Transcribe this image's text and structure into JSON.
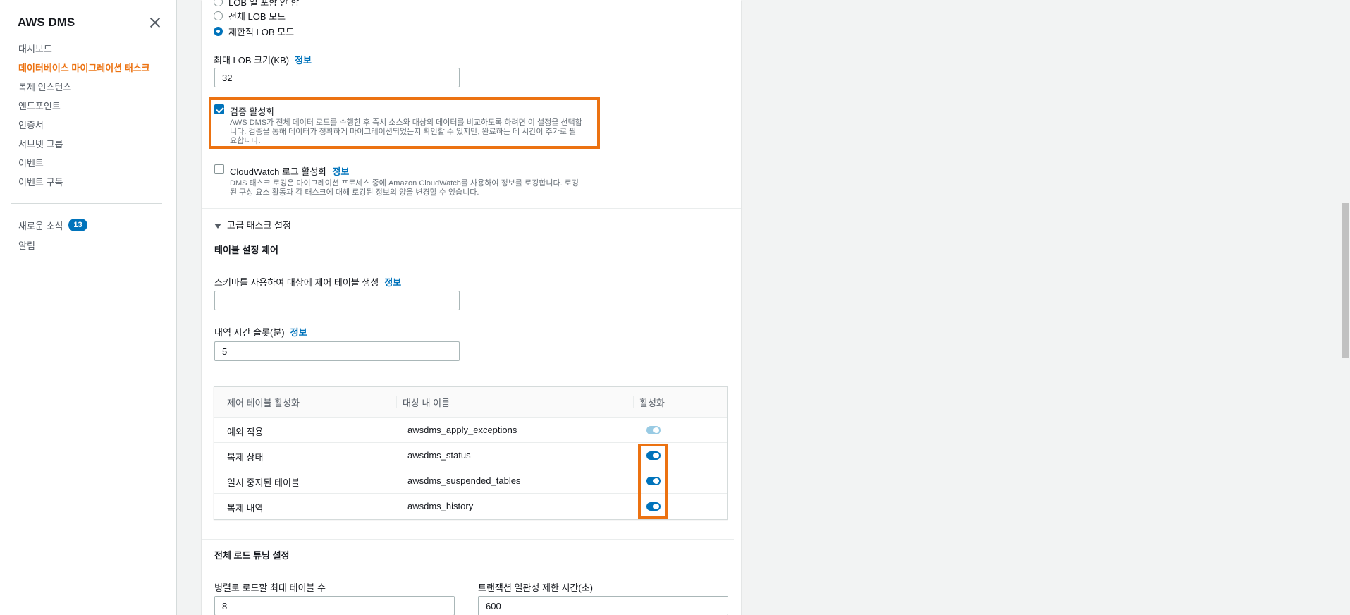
{
  "sidebar": {
    "title": "AWS DMS",
    "items": [
      {
        "label": "대시보드"
      },
      {
        "label": "데이터베이스 마이그레이션 태스크"
      },
      {
        "label": "복제 인스턴스"
      },
      {
        "label": "엔드포인트"
      },
      {
        "label": "인증서"
      },
      {
        "label": "서브넷 그룹"
      },
      {
        "label": "이벤트"
      },
      {
        "label": "이벤트 구독"
      }
    ],
    "news_label": "새로운 소식",
    "news_count": "13",
    "alerts_label": "알림"
  },
  "lob": {
    "cut_option": "LOB 열 포함 안 함",
    "full_option": "전체 LOB 모드",
    "limited_option": "제한적 LOB 모드",
    "max_size_label": "최대 LOB 크기(KB)",
    "max_size_info": "정보",
    "max_size_value": "32"
  },
  "validation": {
    "label": "검증 활성화",
    "checked": true,
    "desc1": "AWS DMS가 전체 데이터 로드를 수행한 후 즉시 소스와 대상의 데이터를 비교하도록 하려면 이 설정을 선택합",
    "desc2": "니다. 검증을 통해 데이터가 정확하게 마이그레이션되었는지 확인할 수 있지만, 완료하는 데 시간이 추가로 필",
    "desc3": "요합니다."
  },
  "cloudwatch": {
    "label": "CloudWatch 로그 활성화",
    "info": "정보",
    "checked": false,
    "desc1": "DMS 태스크 로깅은 마이그레이션 프로세스 중에 Amazon CloudWatch를 사용하여 정보를 로깅합니다. 로깅",
    "desc2": "된 구성 요소 활동과 각 태스크에 대해 로깅된 정보의 양을 변경할 수 있습니다."
  },
  "advanced": {
    "toggle_label": "고급 태스크 설정",
    "control_title": "테이블 설정 제어",
    "schema_label": "스키마를 사용하여 대상에 제어 테이블 생성",
    "schema_info": "정보",
    "schema_value": "",
    "history_label": "내역 시간 슬롯(분)",
    "history_info": "정보",
    "history_value": "5"
  },
  "control_table": {
    "headers": [
      "제어 테이블 활성화",
      "대상 내 이름",
      "활성화"
    ],
    "rows": [
      {
        "name": "예외 적용",
        "target": "awsdms_apply_exceptions",
        "enabled": true,
        "locked": true
      },
      {
        "name": "복제 상태",
        "target": "awsdms_status",
        "enabled": true,
        "locked": false
      },
      {
        "name": "일시 중지된 테이블",
        "target": "awsdms_suspended_tables",
        "enabled": true,
        "locked": false
      },
      {
        "name": "복제 내역",
        "target": "awsdms_history",
        "enabled": true,
        "locked": false
      }
    ]
  },
  "full_load": {
    "title": "전체 로드 튜닝 설정",
    "max_tables_label": "병렬로 로드할 최대 테이블 수",
    "max_tables_value": "8",
    "txn_timeout_label": "트랜잭션 일관성 제한 시간(초)",
    "txn_timeout_value": "600"
  },
  "colors": {
    "accent": "#ec7211",
    "link": "#0073bb"
  }
}
